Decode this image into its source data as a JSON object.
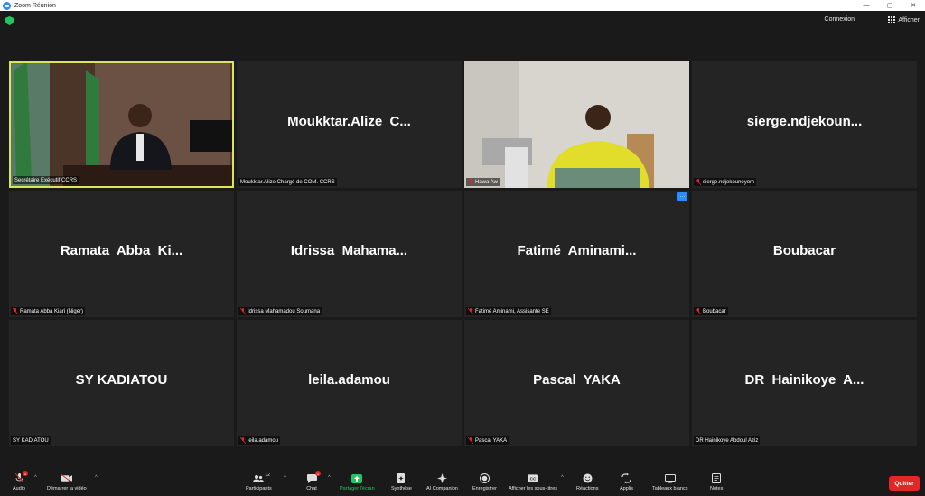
{
  "window": {
    "title": "Zoom Réunion",
    "minimize": "—",
    "maximize": "▢",
    "close": "✕"
  },
  "topbar": {
    "connexion": "Connexion",
    "afficher": "Afficher"
  },
  "tiles": [
    {
      "big": "",
      "label": "Secrétaire Exécutif CCRS",
      "muted": false
    },
    {
      "big": "Moukktar.Alize  C...",
      "label": "Moukktar.Alize Chargé de COM. CCRS",
      "muted": false
    },
    {
      "big": "",
      "label": "Hawa Aw",
      "muted": true
    },
    {
      "big": "sierge.ndjekoun...",
      "label": "sierge.ndjekouneyom",
      "muted": true
    },
    {
      "big": "Ramata  Abba  Ki...",
      "label": "Ramata Abba Kiari (Niger)",
      "muted": true
    },
    {
      "big": "Idrissa  Mahama...",
      "label": "Idrissa Mahamadou Soumana",
      "muted": true
    },
    {
      "big": "Fatimé  Aminami...",
      "label": "Fatimé Aminami, Assisante SE",
      "muted": true
    },
    {
      "big": "Boubacar",
      "label": "Boubacar",
      "muted": true
    },
    {
      "big": "SY KADIATOU",
      "label": "SY KADIATOU",
      "muted": false
    },
    {
      "big": "leila.adamou",
      "label": "leila.adamou",
      "muted": true
    },
    {
      "big": "Pascal  YAKA",
      "label": "Pascal  YAKA",
      "muted": true
    },
    {
      "big": "DR  Hainikoye  A...",
      "label": "DR Hainikoye Abdoul Aziz",
      "muted": false
    }
  ],
  "toolbar": {
    "audio": "Audio",
    "video": "Démarrer la vidéo",
    "participants": "Participants",
    "participants_count": "12",
    "chat": "Chat",
    "chat_badge": "1",
    "share": "Partager l'écran",
    "synthese": "Synthèse",
    "ai": "AI Companion",
    "record": "Enregistrer",
    "subtitles": "Afficher les sous-titres",
    "reactions": "Réactions",
    "apps": "Applis",
    "whiteboards": "Tableaux blancs",
    "notes": "Notes",
    "quit": "Quitter",
    "audio_badge": "1",
    "more": "···"
  },
  "colors": {
    "accent": "#2d8cff",
    "active_speaker": "#d9e55b",
    "quit": "#e02828",
    "share": "#23c55e"
  }
}
